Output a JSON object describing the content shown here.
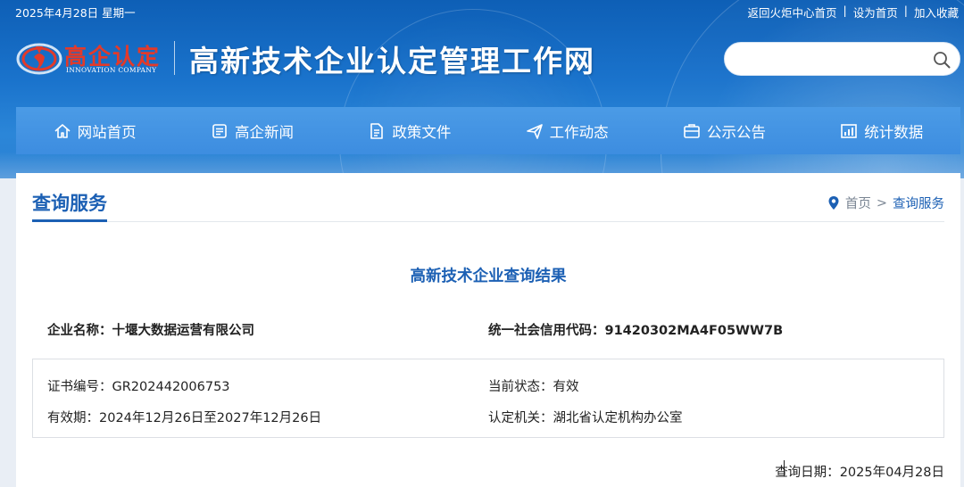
{
  "topbar": {
    "date": "2025年4月28日 星期一",
    "links": [
      "返回火炬中心首页",
      "设为首页",
      "加入收藏"
    ],
    "separator": "|"
  },
  "logo": {
    "brand": "高企认定",
    "sub": "INNOVATION COMPANY",
    "accent_color": "#e23a2a"
  },
  "site_title": "高新技术企业认定管理工作网",
  "search": {
    "placeholder": "",
    "icon": "search-icon"
  },
  "nav": {
    "items": [
      {
        "label": "网站首页",
        "icon": "home-icon"
      },
      {
        "label": "高企新闻",
        "icon": "news-icon"
      },
      {
        "label": "政策文件",
        "icon": "document-icon"
      },
      {
        "label": "工作动态",
        "icon": "send-icon"
      },
      {
        "label": "公示公告",
        "icon": "notice-icon"
      },
      {
        "label": "统计数据",
        "icon": "chart-icon"
      }
    ]
  },
  "page": {
    "title": "查询服务",
    "breadcrumb": {
      "home": "首页",
      "sep": ">",
      "current": "查询服务",
      "icon": "location-pin-icon"
    },
    "accent_color": "#1c60b4"
  },
  "result": {
    "title": "高新技术企业查询结果",
    "company_name_label": "企业名称：",
    "company_name": "十堰大数据运营有限公司",
    "credit_code_label": "统一社会信用代码：",
    "credit_code": "91420302MA4F05WW7B",
    "cert_no_label": "证书编号：",
    "cert_no": "GR202442006753",
    "status_label": "当前状态：",
    "status": "有效",
    "validity_label": "有效期：",
    "validity": "2024年12月26日至2027年12月26日",
    "authority_label": "认定机关：",
    "authority": "湖北省认定机构办公室",
    "query_date_label": "查询日期：",
    "query_date": "2025年04月28日"
  }
}
